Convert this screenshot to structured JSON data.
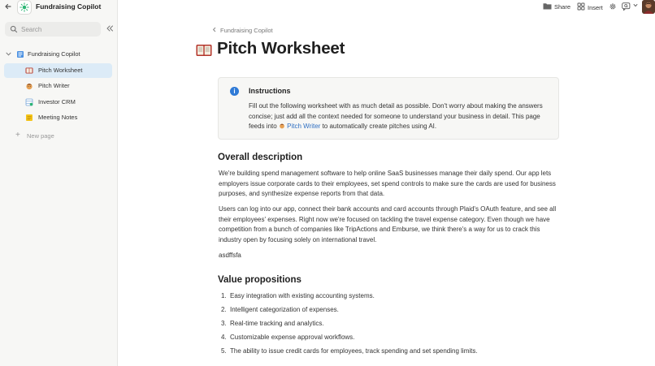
{
  "app": {
    "title": "Fundraising Copilot"
  },
  "sidebar": {
    "search_placeholder": "Search",
    "root_label": "Fundraising Copilot",
    "items": [
      {
        "label": "Pitch Worksheet",
        "icon": "book-icon",
        "active": true
      },
      {
        "label": "Pitch Writer",
        "icon": "person-emoji-icon",
        "active": false
      },
      {
        "label": "Investor CRM",
        "icon": "database-icon",
        "active": false
      },
      {
        "label": "Meeting Notes",
        "icon": "note-icon",
        "active": false
      }
    ],
    "new_page_label": "New page"
  },
  "toolbar": {
    "share_label": "Share",
    "insert_label": "Insert"
  },
  "page": {
    "breadcrumb": "Fundraising Copilot",
    "title": "Pitch Worksheet",
    "callout": {
      "title": "Instructions",
      "text_before": "Fill out the following worksheet with as much detail as possible. Don't worry about making the answers concise; just add all the context needed for someone to understand your business in detail. This page feeds into ",
      "link_label": "Pitch Writer",
      "text_after": " to automatically create pitches using AI."
    },
    "overall": {
      "heading": "Overall description",
      "p1": "We're building spend management software to help online SaaS businesses manage their daily spend. Our app lets employers issue corporate cards to their employees, set spend controls to make sure the cards are used for business purposes, and synthesize expense reports from that data.",
      "p2": "Users can log into our app, connect their bank accounts and card accounts through Plaid's OAuth feature, and see all their employees' expenses. Right now we're focused on tackling the travel expense category. Even though we have competition from a bunch of companies like TripActions and Emburse, we think there's a way for us to crack this industry open by focusing solely on international travel.",
      "p3": "asdffsfa"
    },
    "value_props": {
      "heading": "Value propositions",
      "items": [
        {
          "num": "1.",
          "text": "Easy integration with existing accounting systems."
        },
        {
          "num": "2.",
          "text": "Intelligent categorization of expenses."
        },
        {
          "num": "3.",
          "text": "Real-time tracking and analytics."
        },
        {
          "num": "4.",
          "text": "Customizable expense approval workflows."
        },
        {
          "num": "5.",
          "text": "The ability to issue credit cards for employees, track spending and set spending limits."
        }
      ]
    }
  },
  "colors": {
    "accent": "#2f7ad6",
    "link": "#2f6fc2",
    "active_item_bg": "#dcebf7",
    "sidebar_bg": "#f7f7f5"
  }
}
